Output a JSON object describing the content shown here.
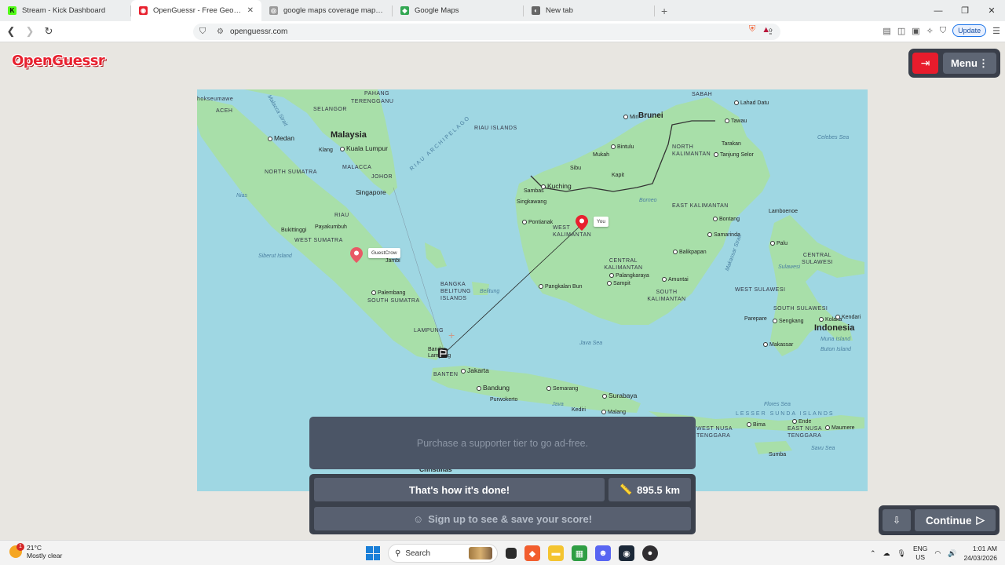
{
  "browser": {
    "tabs": [
      {
        "title": "Stream - Kick Dashboard",
        "favicon_color": "#53fc18",
        "favicon_glyph": "K"
      },
      {
        "title": "OpenGuessr - Free GeoGuessr",
        "favicon_color": "#e8212f",
        "favicon_glyph": "◉",
        "active": true
      },
      {
        "title": "google maps coverage map world - Go",
        "favicon_color": "#9a9a9a",
        "favicon_glyph": "◎"
      },
      {
        "title": "Google Maps",
        "favicon_color": "#34a853",
        "favicon_glyph": "◆"
      },
      {
        "title": "New tab",
        "favicon_color": "#666666",
        "favicon_glyph": "◐"
      }
    ],
    "new_tab_glyph": "+",
    "address": "openguessr.com",
    "update_label": "Update"
  },
  "app": {
    "logo_text": "OpenGuessr",
    "menu_label": "Menu",
    "ad_text": "Purchase a supporter tier to go ad-free.",
    "result_text": "That's how it's done!",
    "distance": "895.5 km",
    "signup_text": "Sign up to see & save your score!",
    "continue_label": "Continue"
  },
  "map": {
    "pins": {
      "you_label": "You",
      "guest_label": "GuestCrow"
    },
    "labels": {
      "malaysia": "Malaysia",
      "medan": "Medan",
      "kuala_lumpur": "Kuala Lumpur",
      "klang": "Klang",
      "singapore": "Singapore",
      "malacca": "MALACCA",
      "johor": "JOHOR",
      "terengganu": "TERENGGANU",
      "selangor": "SELANGOR",
      "pahang": "PAHANG",
      "aceh": "ACEH",
      "nanggroe": "hokseumawe",
      "north_sumatra": "NORTH SUMATRA",
      "nias": "Nias",
      "riau": "RIAU",
      "bukittinggi": "Bukittinggi",
      "payakumbuh": "Payakumbuh",
      "west_sumatra": "WEST SUMATRA",
      "siberut": "Siberut Island",
      "jambi": "Jambi",
      "palembang": "Palembang",
      "south_sumatra": "SOUTH SUMATRA",
      "bangka": "BANGKA BELITUNG ISLANDS",
      "belitung": "Belitung",
      "lampung": "LAMPUNG",
      "bandar": "Bandar Lampung",
      "banten": "BANTEN",
      "jakarta": "Jakarta",
      "bandung": "Bandung",
      "purwokerto": "Purwokerto",
      "semarang": "Semarang",
      "java": "Java",
      "kediri": "Kediri",
      "malang": "Malang",
      "surabaya": "Surabaya",
      "java_sea": "Java Sea",
      "christmas": "Christmas",
      "riau_islands": "RIAU ISLANDS",
      "riau_arch": "RIAU ARCHIPELAGO",
      "sabah": "SABAH",
      "brunei": "Brunei",
      "miri": "Miri",
      "bintulu": "Bintulu",
      "mukah": "Mukah",
      "sibu": "Sibu",
      "kapit": "Kapit",
      "kuching": "Kuching",
      "sambas": "Sambas",
      "singkawang": "Singkawang",
      "pontianak": "Pontianak",
      "west_kal": "WEST KALIMANTAN",
      "borneo": "Borneo",
      "north_kal": "NORTH KALIMANTAN",
      "tawau": "Tawau",
      "tarakan": "Tarakan",
      "tanjung": "Tanjung Selor",
      "east_kal": "EAST KALIMANTAN",
      "bontang": "Bontang",
      "samarinda": "Samarinda",
      "balikpapan": "Balikpapan",
      "central_kal": "CENTRAL KALIMANTAN",
      "palangkaraya": "Palangkaraya",
      "sampit": "Sampit",
      "pangkalan": "Pangkalan Bun",
      "amuntai": "Amuntai",
      "south_kal": "SOUTH KALIMANTAN",
      "lahad": "Lahad Datu",
      "celebes": "Celebes Sea",
      "lamboenoe": "Lamboenoe",
      "makassar_strait": "Makassar Strait",
      "palu": "Palu",
      "central_sul": "CENTRAL SULAWESI",
      "sulawesi": "Sulawesi",
      "south_sul": "SOUTH SULAWESI",
      "west_sul": "WEST SULAWESI",
      "parepare": "Parepare",
      "sengkang": "Sengkang",
      "kolaka": "Kolaka",
      "kendari": "Kendari",
      "indonesia": "Indonesia",
      "muna": "Muna Island",
      "buton": "Buton Island",
      "makassar": "Makassar",
      "flores_sea": "Flores Sea",
      "lesser_sunda": "LESSER SUNDA ISLANDS",
      "west_nusa": "WEST NUSA TENGGARA",
      "east_nusa": "EAST NUSA TENGGARA",
      "bima": "Bima",
      "ende": "Ende",
      "maumere": "Maumere",
      "sumba": "Sumba",
      "savu": "Savu Sea",
      "malacca_strait": "Malacca Strait"
    }
  },
  "taskbar": {
    "temperature": "21°C",
    "weather": "Mostly clear",
    "weather_badge": "1",
    "search_label": "Search",
    "lang_top": "ENG",
    "lang_bottom": "US",
    "time": "1:01 AM",
    "date": "24/03/2026"
  }
}
